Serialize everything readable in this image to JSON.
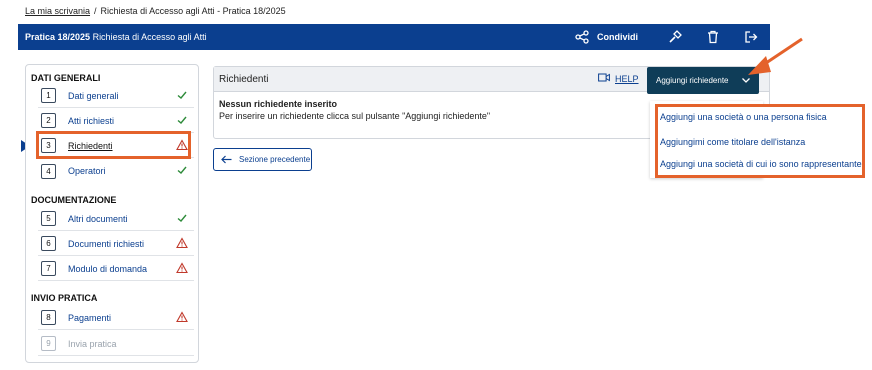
{
  "breadcrumb": {
    "home": "La mia scrivania",
    "separator": "/",
    "current": "Richiesta di Accesso agli Atti - Pratica 18/2025"
  },
  "topbar": {
    "title_bold": "Pratica 18/2025",
    "title_rest": " Richiesta di Accesso agli Atti",
    "share_label": "Condividi",
    "icons": [
      "share-icon",
      "wrench-icon",
      "trash-icon",
      "logout-icon"
    ],
    "bg_color": "#0b3f8f"
  },
  "sidebar": {
    "sections": [
      {
        "title": "DATI GENERALI"
      },
      {
        "title": "DOCUMENTAZIONE"
      },
      {
        "title": "INVIO PRATICA"
      }
    ],
    "items": [
      {
        "num": "1",
        "label": "Dati generali",
        "status": "check"
      },
      {
        "num": "2",
        "label": "Atti richiesti",
        "status": "check"
      },
      {
        "num": "3",
        "label": "Richiedenti",
        "status": "warning",
        "active": true
      },
      {
        "num": "4",
        "label": "Operatori",
        "status": "check"
      },
      {
        "num": "5",
        "label": "Altri documenti",
        "status": "check"
      },
      {
        "num": "6",
        "label": "Documenti richiesti",
        "status": "warning"
      },
      {
        "num": "7",
        "label": "Modulo di domanda",
        "status": "warning"
      },
      {
        "num": "8",
        "label": "Pagamenti",
        "status": "warning"
      },
      {
        "num": "9",
        "label": "Invia pratica",
        "status": "none",
        "disabled": true
      }
    ]
  },
  "panel": {
    "title": "Richiedenti",
    "help_label": "HELP",
    "add_button": "Aggiungi richiedente",
    "empty_title": "Nessun richiedente inserito",
    "empty_text": "Per inserire un richiedente clicca sul pulsante \"Aggiungi richiedente\""
  },
  "prev_button": "Sezione precedente",
  "dropdown": {
    "options": [
      "Aggiungi una società o una persona fisica",
      "Aggiungimi come titolare dell'istanza",
      "Aggiungi una società di cui io sono rappresentante"
    ]
  },
  "colors": {
    "accent": "#0b3f8f",
    "highlight": "#e4622b",
    "success": "#2e8b3a",
    "warning": "#c0392b",
    "button_dark": "#0f3d58"
  }
}
